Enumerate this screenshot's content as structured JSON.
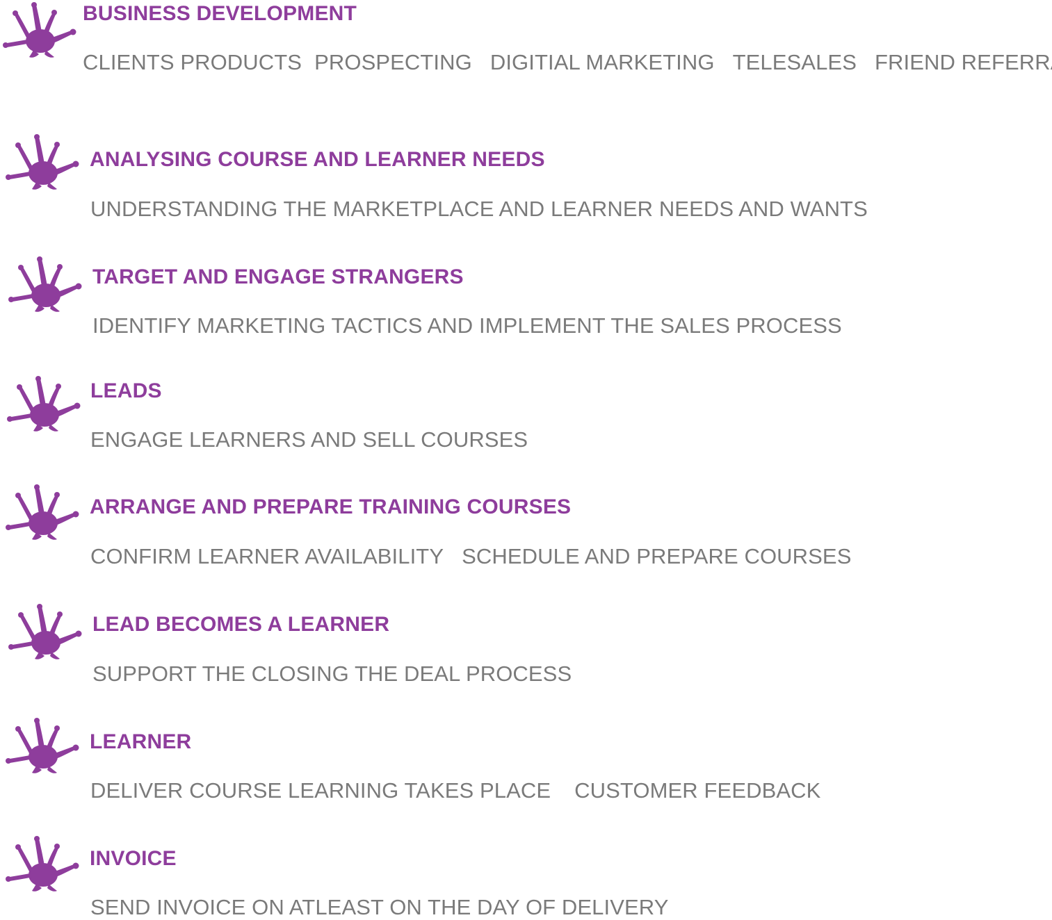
{
  "colors": {
    "heading": "#8e3d9c",
    "detail": "#7a7a7a",
    "icon": "#8e3d9c"
  },
  "icon_name": "purple-splat-icon",
  "steps": [
    {
      "heading": "BUSINESS DEVELOPMENT",
      "details": [
        "CLIENTS PRODUCTS",
        "PROSPECTING",
        "DIGITIAL MARKETING",
        "TELESALES",
        "FRIEND REFERRALS"
      ]
    },
    {
      "heading": "ANALYSING COURSE AND LEARNER NEEDS",
      "details": [
        "UNDERSTANDING THE MARKETPLACE AND LEARNER NEEDS AND WANTS"
      ]
    },
    {
      "heading": "TARGET AND ENGAGE STRANGERS",
      "details": [
        "IDENTIFY MARKETING TACTICS AND IMPLEMENT THE SALES PROCESS"
      ]
    },
    {
      "heading": "LEADS",
      "details": [
        "ENGAGE LEARNERS AND SELL COURSES"
      ]
    },
    {
      "heading": "ARRANGE AND PREPARE TRAINING COURSES",
      "details": [
        "CONFIRM LEARNER AVAILABILITY",
        "SCHEDULE AND PREPARE COURSES"
      ]
    },
    {
      "heading": "LEAD BECOMES A LEARNER",
      "details": [
        "SUPPORT THE CLOSING THE DEAL PROCESS"
      ]
    },
    {
      "heading": "LEARNER",
      "details": [
        "DELIVER COURSE LEARNING TAKES PLACE",
        "CUSTOMER FEEDBACK"
      ]
    },
    {
      "heading": "INVOICE",
      "details": [
        "SEND INVOICE ON ATLEAST ON THE DAY OF DELIVERY"
      ]
    }
  ]
}
